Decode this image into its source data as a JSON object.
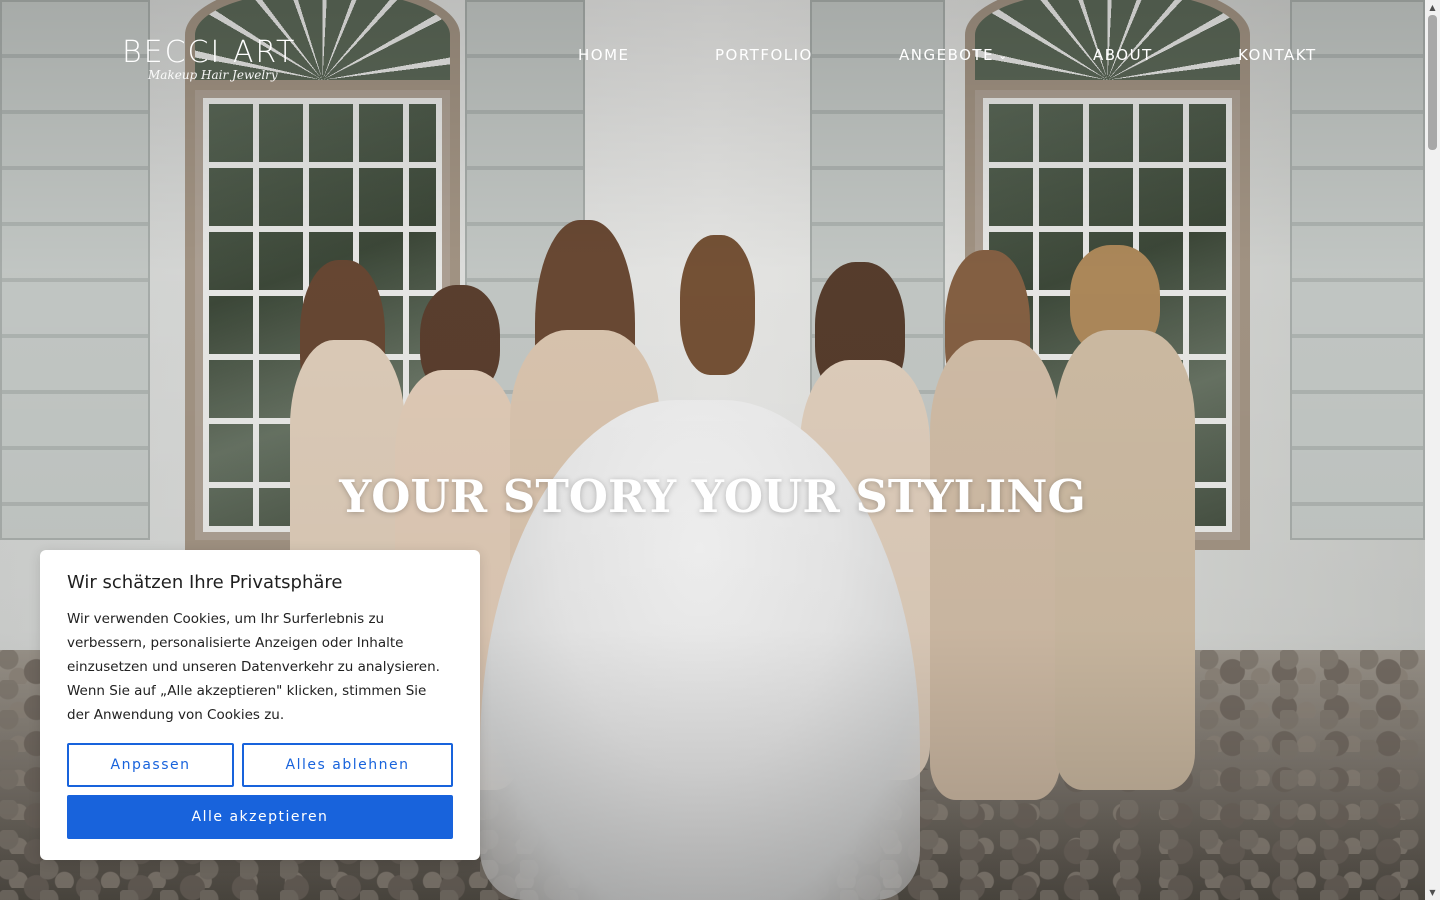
{
  "header": {
    "logo_main": "BECCI ART",
    "logo_sub": "Makeup Hair Jewelry",
    "nav": [
      {
        "label": "HOME"
      },
      {
        "label": "PORTFOLIO"
      },
      {
        "label": "ANGEBOTE",
        "has_dropdown": true
      },
      {
        "label": "ABOUT"
      },
      {
        "label": "KONTAKT"
      }
    ]
  },
  "hero": {
    "title": "YOUR STORY YOUR STYLING"
  },
  "cookie": {
    "title": "Wir schätzen Ihre Privatsphäre",
    "text": "Wir verwenden Cookies, um Ihr Surferlebnis zu verbessern, personalisierte Anzeigen oder Inhalte einzusetzen und unseren Datenverkehr zu analysieren. Wenn Sie auf „Alle akzeptieren\" klicken, stimmen Sie der Anwendung von Cookies zu.",
    "customize_label": "Anpassen",
    "reject_label": "Alles ablehnen",
    "accept_label": "Alle akzeptieren",
    "accent_color": "#1863dc"
  },
  "icons": {
    "dropdown": "chevron-down-icon",
    "scroll_up": "scroll-up-arrow-icon",
    "scroll_down": "scroll-down-arrow-icon"
  }
}
